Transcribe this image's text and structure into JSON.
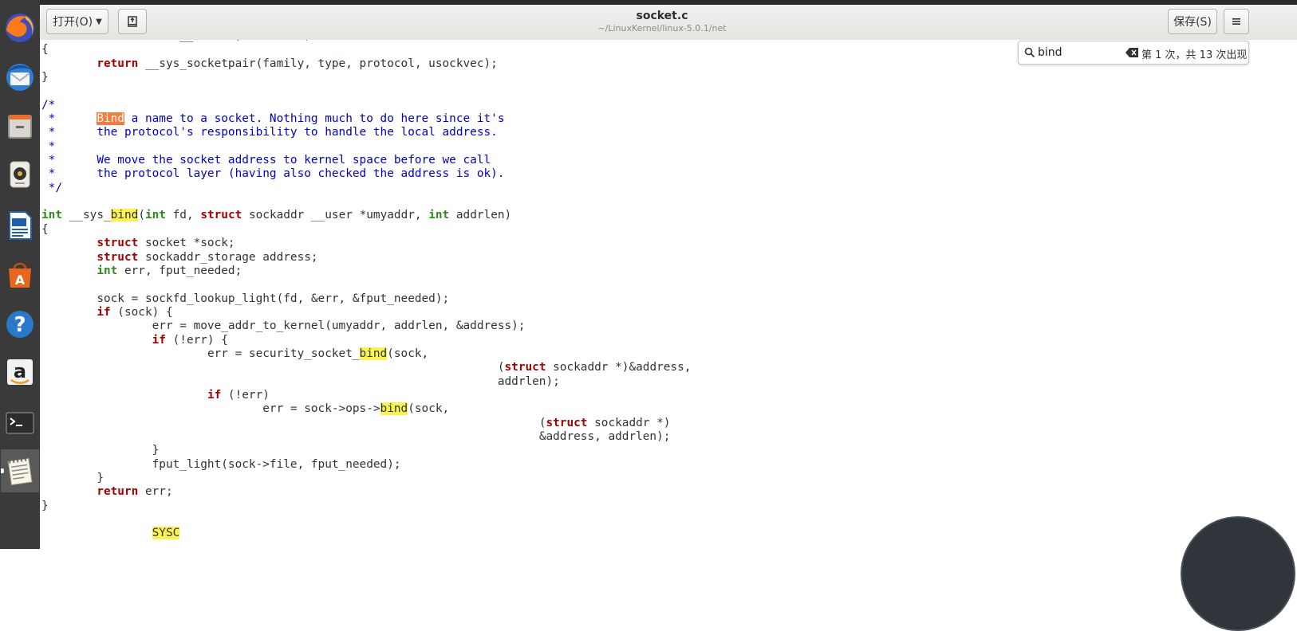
{
  "window": {
    "title": "socket.c",
    "path": "~/LinuxKernel/linux-5.0.1/net"
  },
  "headerbar": {
    "open_label": "打开(O)",
    "save_label": "保存(S)"
  },
  "search": {
    "query": "bind",
    "match_status": "第 1 次，共 13 次出现"
  },
  "colors": {
    "type_keyword": "#2e8b20",
    "statement_keyword": "#a40000",
    "comment": "#0000c8",
    "match_highlight": "#fcf24f",
    "current_match": "#f57b3a"
  },
  "dock": [
    {
      "name": "firefox-icon"
    },
    {
      "name": "thunderbird-icon"
    },
    {
      "name": "files-icon"
    },
    {
      "name": "rhythmbox-icon"
    },
    {
      "name": "writer-icon"
    },
    {
      "name": "software-center-icon"
    },
    {
      "name": "help-icon"
    },
    {
      "name": "amazon-icon"
    },
    {
      "name": "terminal-icon"
    },
    {
      "name": "text-editor-icon",
      "active": true
    }
  ],
  "code_lines": [
    [
      {
        "t": "\t\t"
      },
      {
        "t": "int",
        "c": "type"
      },
      {
        "t": " __user *, usockvec)"
      }
    ],
    [
      {
        "t": "{"
      }
    ],
    [
      {
        "t": "\t"
      },
      {
        "t": "return",
        "c": "kw"
      },
      {
        "t": " __sys_socketpair(family, type, protocol, usockvec);"
      }
    ],
    [
      {
        "t": "}"
      }
    ],
    [
      {
        "t": ""
      }
    ],
    [
      {
        "t": "/*",
        "c": "cm"
      }
    ],
    [
      {
        "t": " *\t",
        "c": "cm"
      },
      {
        "t": "Bind",
        "c": "cm hl-cur"
      },
      {
        "t": " a name to a socket. Nothing much to do here since it's",
        "c": "cm"
      }
    ],
    [
      {
        "t": " *\tthe protocol's responsibility to handle the local address.",
        "c": "cm"
      }
    ],
    [
      {
        "t": " *",
        "c": "cm"
      }
    ],
    [
      {
        "t": " *\tWe move the socket address to kernel space before we call",
        "c": "cm"
      }
    ],
    [
      {
        "t": " *\tthe protocol layer (having also checked the address is ok).",
        "c": "cm"
      }
    ],
    [
      {
        "t": " */",
        "c": "cm"
      }
    ],
    [
      {
        "t": ""
      }
    ],
    [
      {
        "t": "int",
        "c": "type"
      },
      {
        "t": " __sys_"
      },
      {
        "t": "bind",
        "c": "hl"
      },
      {
        "t": "("
      },
      {
        "t": "int",
        "c": "type"
      },
      {
        "t": " fd, "
      },
      {
        "t": "struct",
        "c": "kw"
      },
      {
        "t": " sockaddr __user *umyaddr, "
      },
      {
        "t": "int",
        "c": "type"
      },
      {
        "t": " addrlen)"
      }
    ],
    [
      {
        "t": "{"
      }
    ],
    [
      {
        "t": "\t"
      },
      {
        "t": "struct",
        "c": "kw"
      },
      {
        "t": " socket *sock;"
      }
    ],
    [
      {
        "t": "\t"
      },
      {
        "t": "struct",
        "c": "kw"
      },
      {
        "t": " sockaddr_storage address;"
      }
    ],
    [
      {
        "t": "\t"
      },
      {
        "t": "int",
        "c": "type"
      },
      {
        "t": " err, fput_needed;"
      }
    ],
    [
      {
        "t": ""
      }
    ],
    [
      {
        "t": "\tsock = sockfd_lookup_light(fd, &err, &fput_needed);"
      }
    ],
    [
      {
        "t": "\t"
      },
      {
        "t": "if",
        "c": "kw"
      },
      {
        "t": " (sock) {"
      }
    ],
    [
      {
        "t": "\t\terr = move_addr_to_kernel(umyaddr, addrlen, &address);"
      }
    ],
    [
      {
        "t": "\t\t"
      },
      {
        "t": "if",
        "c": "kw"
      },
      {
        "t": " (!err) {"
      }
    ],
    [
      {
        "t": "\t\t\terr = security_socket_"
      },
      {
        "t": "bind",
        "c": "hl"
      },
      {
        "t": "(sock,"
      }
    ],
    [
      {
        "t": "\t\t\t\t\t\t\t\t  ("
      },
      {
        "t": "struct",
        "c": "kw"
      },
      {
        "t": " sockaddr *)&address,"
      }
    ],
    [
      {
        "t": "\t\t\t\t\t\t\t\t  addrlen);"
      }
    ],
    [
      {
        "t": "\t\t\t"
      },
      {
        "t": "if",
        "c": "kw"
      },
      {
        "t": " (!err)"
      }
    ],
    [
      {
        "t": "\t\t\t\terr = sock->ops->"
      },
      {
        "t": "bind",
        "c": "hl"
      },
      {
        "t": "(sock,"
      }
    ],
    [
      {
        "t": "\t\t\t\t\t\t\t\t\t("
      },
      {
        "t": "struct",
        "c": "kw"
      },
      {
        "t": " sockaddr *)"
      }
    ],
    [
      {
        "t": "\t\t\t\t\t\t\t\t\t&address, addrlen);"
      }
    ],
    [
      {
        "t": "\t\t}"
      }
    ],
    [
      {
        "t": "\t\tfput_light(sock->file, fput_needed);"
      }
    ],
    [
      {
        "t": "\t}"
      }
    ],
    [
      {
        "t": "\t"
      },
      {
        "t": "return",
        "c": "kw"
      },
      {
        "t": " err;"
      }
    ],
    [
      {
        "t": "}"
      }
    ],
    [
      {
        "t": ""
      }
    ],
    [
      {
        "t": "\t\t"
      },
      {
        "t": "SYSC",
        "c": "hl"
      }
    ]
  ]
}
